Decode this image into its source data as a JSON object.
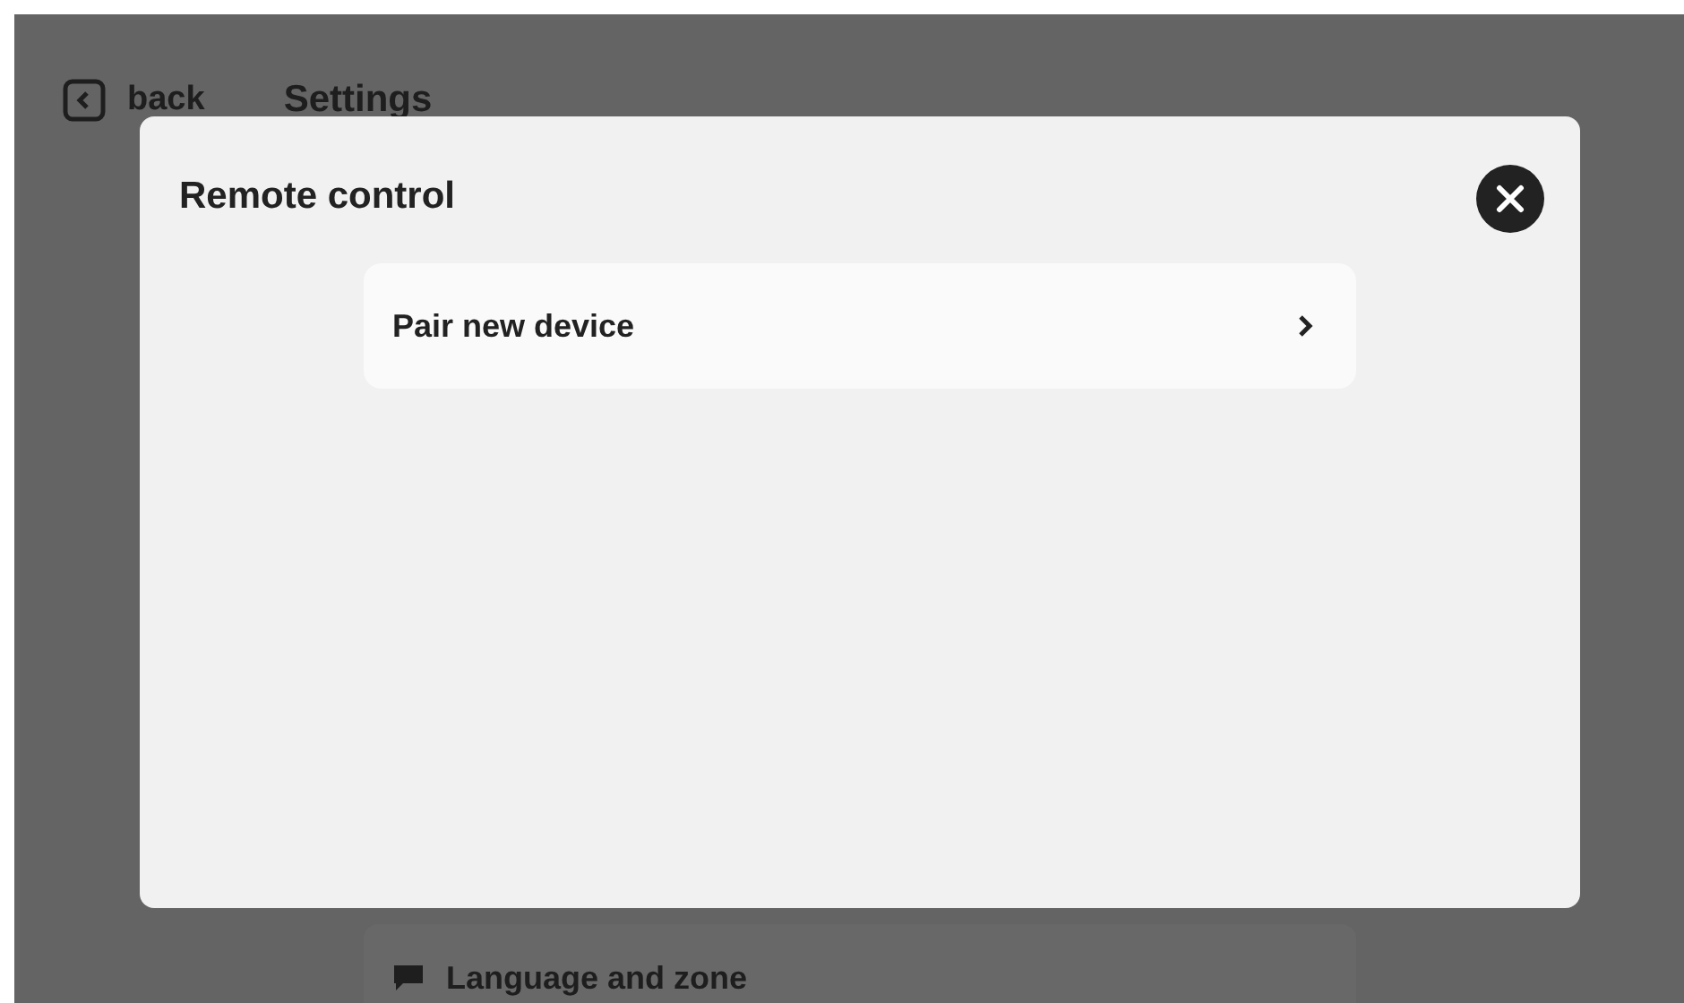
{
  "header": {
    "back_label": "back",
    "title": "Settings"
  },
  "background_items": [
    {
      "label": "Language and zone"
    }
  ],
  "dialog": {
    "title": "Remote control",
    "items": [
      {
        "label": "Pair new device"
      }
    ]
  }
}
